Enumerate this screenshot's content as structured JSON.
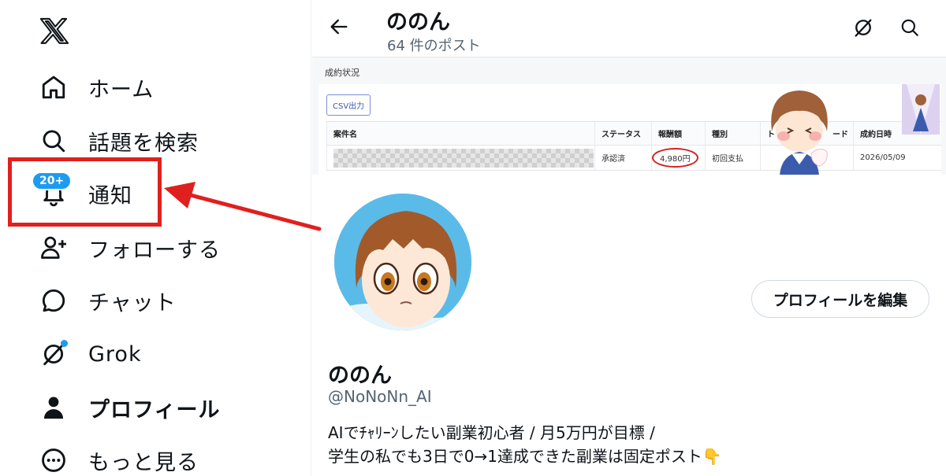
{
  "sidebar": {
    "logo": "x-logo",
    "items": [
      {
        "icon": "home-icon",
        "label": "ホーム",
        "bold": false
      },
      {
        "icon": "search-icon",
        "label": "話題を検索",
        "bold": false
      },
      {
        "icon": "bell-icon",
        "label": "通知",
        "bold": false,
        "badge": "20+"
      },
      {
        "icon": "follow-icon",
        "label": "フォローする",
        "bold": false
      },
      {
        "icon": "chat-icon",
        "label": "チャット",
        "bold": false
      },
      {
        "icon": "grok-icon",
        "label": "Grok",
        "bold": false
      },
      {
        "icon": "person-icon",
        "label": "プロフィール",
        "bold": true
      },
      {
        "icon": "more-icon",
        "label": "もっと見る",
        "bold": false
      }
    ],
    "annotation_color": "#e0201e"
  },
  "header": {
    "name": "ののん",
    "post_count": "64 件のポスト"
  },
  "banner": {
    "title": "成約状況",
    "csv_button": "CSV出力",
    "table": {
      "headers": [
        "案件名",
        "ステータス",
        "報酬額",
        "種別",
        "ト",
        "ード",
        "成約日時"
      ],
      "row": {
        "status": "承認済",
        "amount": "4,980円",
        "type": "初回支払",
        "date": "2026/05/09"
      }
    }
  },
  "profile": {
    "name": "ののん",
    "handle": "@NoNoNn_AI",
    "edit_button": "プロフィールを編集",
    "bio_line1": "AIでﾁｬﾘｰﾝしたい副業初心者 / 月5万円が目標 /",
    "bio_line2": "学生の私でも3日で0→1達成できた副業は固定ポスト👇"
  },
  "colors": {
    "accent": "#1d9bf0",
    "text": "#0f1419",
    "secondary": "#536471",
    "annotation": "#e0201e"
  }
}
